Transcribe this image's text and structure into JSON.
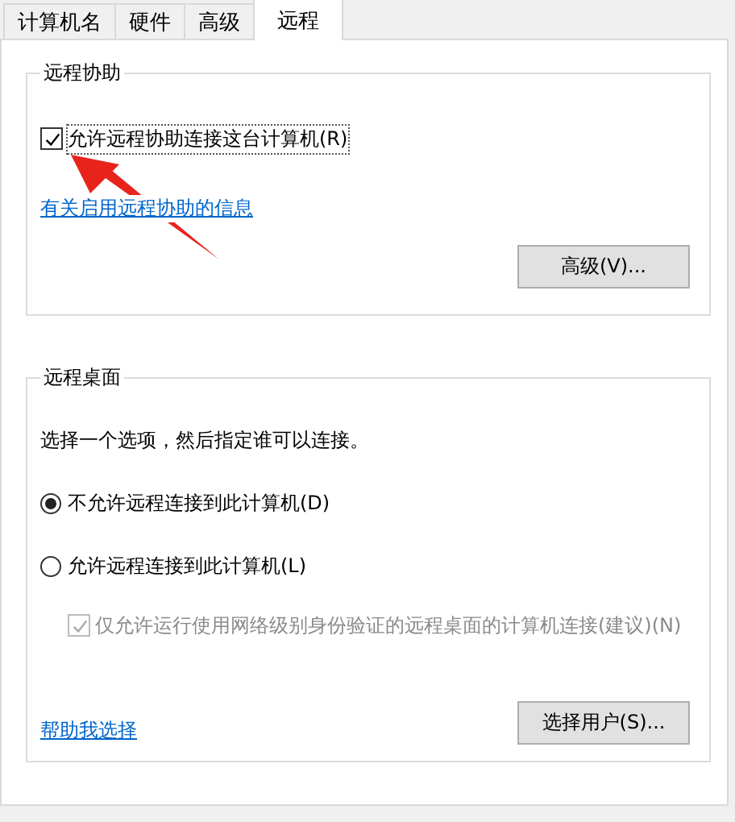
{
  "tabs": [
    {
      "label": "计算机名",
      "selected": false
    },
    {
      "label": "硬件",
      "selected": false
    },
    {
      "label": "高级",
      "selected": false
    },
    {
      "label": "远程",
      "selected": true
    }
  ],
  "remote_assistance": {
    "title": "远程协助",
    "allow": {
      "label": "允许远程协助连接这台计算机(R)",
      "checked": true
    },
    "info_link": "有关启用远程协助的信息",
    "advanced_button": "高级(V)..."
  },
  "remote_desktop": {
    "title": "远程桌面",
    "instruction": "选择一个选项，然后指定谁可以连接。",
    "options": [
      {
        "label": "不允许远程连接到此计算机(D)",
        "selected": true
      },
      {
        "label": "允许远程连接到此计算机(L)",
        "selected": false
      }
    ],
    "nla": {
      "label": "仅允许运行使用网络级别身份验证的远程桌面的计算机连接(建议)(N)",
      "checked": true,
      "disabled": true
    },
    "help_link": "帮助我选择",
    "select_users_button": "选择用户(S)..."
  }
}
